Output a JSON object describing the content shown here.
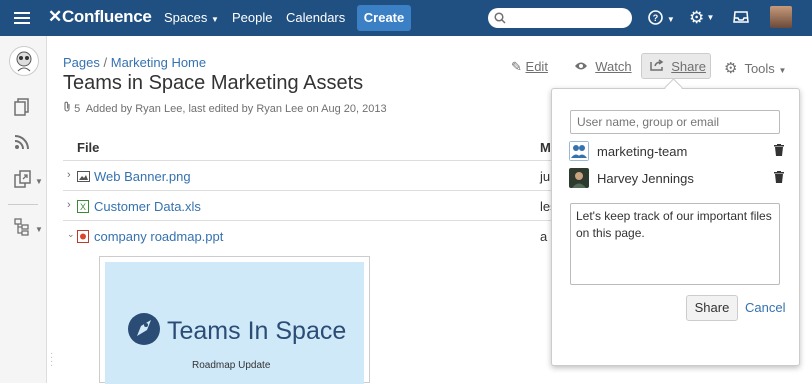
{
  "header": {
    "app_name": "Confluence",
    "nav": [
      "Spaces",
      "People",
      "Calendars"
    ],
    "create_label": "Create",
    "brand_color": "#205081"
  },
  "page": {
    "breadcrumb": [
      "Pages",
      "Marketing Home"
    ],
    "breadcrumb_sep": "/",
    "title": "Teams in Space Marketing Assets",
    "attachments_count": "5",
    "meta": "Added by Ryan Lee, last edited by Ryan Lee on Aug 20, 2013"
  },
  "actions": {
    "edit": "Edit",
    "watch": "Watch",
    "share": "Share",
    "tools": "Tools"
  },
  "table": {
    "col_file": "File",
    "col_second": "M",
    "rows": [
      {
        "name": "Web Banner.png",
        "trunc": "ju",
        "icon": "image-file-icon",
        "expanded": false
      },
      {
        "name": "Customer Data.xls",
        "trunc": "les",
        "icon": "excel-file-icon",
        "expanded": false
      },
      {
        "name": "company roadmap.ppt",
        "trunc": "a",
        "icon": "ppt-file-icon",
        "expanded": true
      }
    ]
  },
  "preview": {
    "title": "Teams In Space",
    "subtitle": "Roadmap Update"
  },
  "share_dialog": {
    "input_placeholder": "User name, group or email",
    "recipients": [
      {
        "name": "marketing-team",
        "type": "group"
      },
      {
        "name": "Harvey Jennings",
        "type": "user"
      }
    ],
    "message": "Let's keep track of our important files on this page.",
    "share_label": "Share",
    "cancel_label": "Cancel"
  }
}
